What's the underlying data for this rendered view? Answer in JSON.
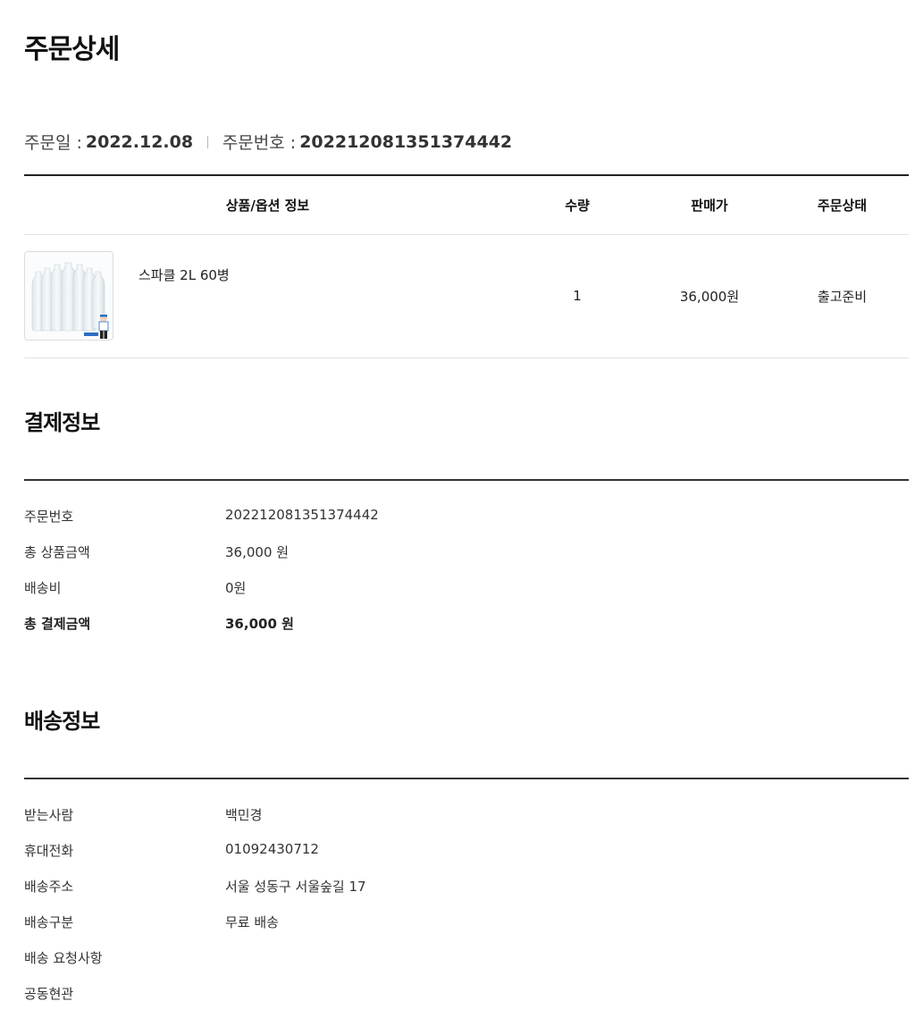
{
  "page_title": "주문상세",
  "order_meta": {
    "date_label": "주문일 :",
    "date_value": "2022.12.08",
    "separator": "|",
    "number_label": "주문번호 :",
    "number_value": "202212081351374442"
  },
  "product_table": {
    "headers": {
      "info": "상품/옵션 정보",
      "qty": "수량",
      "price": "판매가",
      "status": "주문상태"
    },
    "rows": [
      {
        "name": "스파클 2L 60병",
        "qty": "1",
        "price": "36,000원",
        "status": "출고준비"
      }
    ]
  },
  "payment": {
    "title": "결제정보",
    "rows": [
      {
        "label": "주문번호",
        "value": "202212081351374442"
      },
      {
        "label": "총 상품금액",
        "value": "36,000 원"
      },
      {
        "label": "배송비",
        "value": "0원"
      },
      {
        "label": "총 결제금액",
        "value": "36,000 원"
      }
    ]
  },
  "shipping": {
    "title": "배송정보",
    "rows": [
      {
        "label": "받는사람",
        "value": "백민경"
      },
      {
        "label": "휴대전화",
        "value": "01092430712"
      },
      {
        "label": "배송주소",
        "value": "서울 성동구 서울숲길 17"
      },
      {
        "label": "배송구분",
        "value": "무료 배송"
      },
      {
        "label": "배송 요청사항",
        "value": ""
      },
      {
        "label": "공동현관",
        "value": ""
      }
    ]
  }
}
